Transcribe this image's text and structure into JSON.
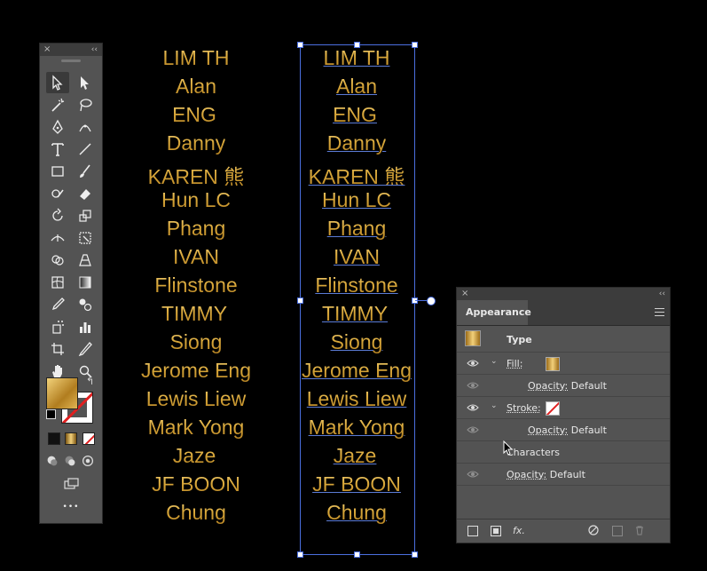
{
  "tools_panel": {
    "close_glyph": "×",
    "collapse_glyph": "‹‹",
    "more_glyph": "•••",
    "fill_color": "#d4a33a",
    "stroke": "none"
  },
  "names_left": [
    "LIM TH",
    "Alan",
    "ENG",
    "Danny",
    "KAREN 熊",
    "Hun LC",
    "Phang",
    "IVAN",
    "Flinstone",
    "TIMMY",
    "Siong",
    "Jerome Eng",
    "Lewis Liew",
    "Mark Yong",
    "Jaze",
    "JF BOON",
    "Chung"
  ],
  "names_right": [
    "LIM TH",
    "Alan",
    "ENG",
    "Danny",
    "KAREN 熊",
    "Hun LC",
    "Phang",
    "IVAN",
    "Flinstone",
    "TIMMY",
    "Siong",
    "Jerome Eng",
    "Lewis Liew",
    "Mark Yong",
    "Jaze",
    "JF BOON",
    "Chung"
  ],
  "appearance": {
    "close_glyph": "×",
    "collapse_glyph": "‹‹",
    "tab": "Appearance",
    "header": "Type",
    "fill_label": "Fill:",
    "fill_opacity_label": "Opacity:",
    "fill_opacity_value": "Default",
    "stroke_label": "Stroke:",
    "stroke_opacity_label": "Opacity:",
    "stroke_opacity_value": "Default",
    "characters_label": "Characters",
    "opacity_label": "Opacity:",
    "opacity_value": "Default",
    "fx_label": "fx."
  },
  "colors": {
    "accent_blue": "#4b6fe0",
    "gold": "#d4a33a",
    "panel_bg": "#535353"
  }
}
